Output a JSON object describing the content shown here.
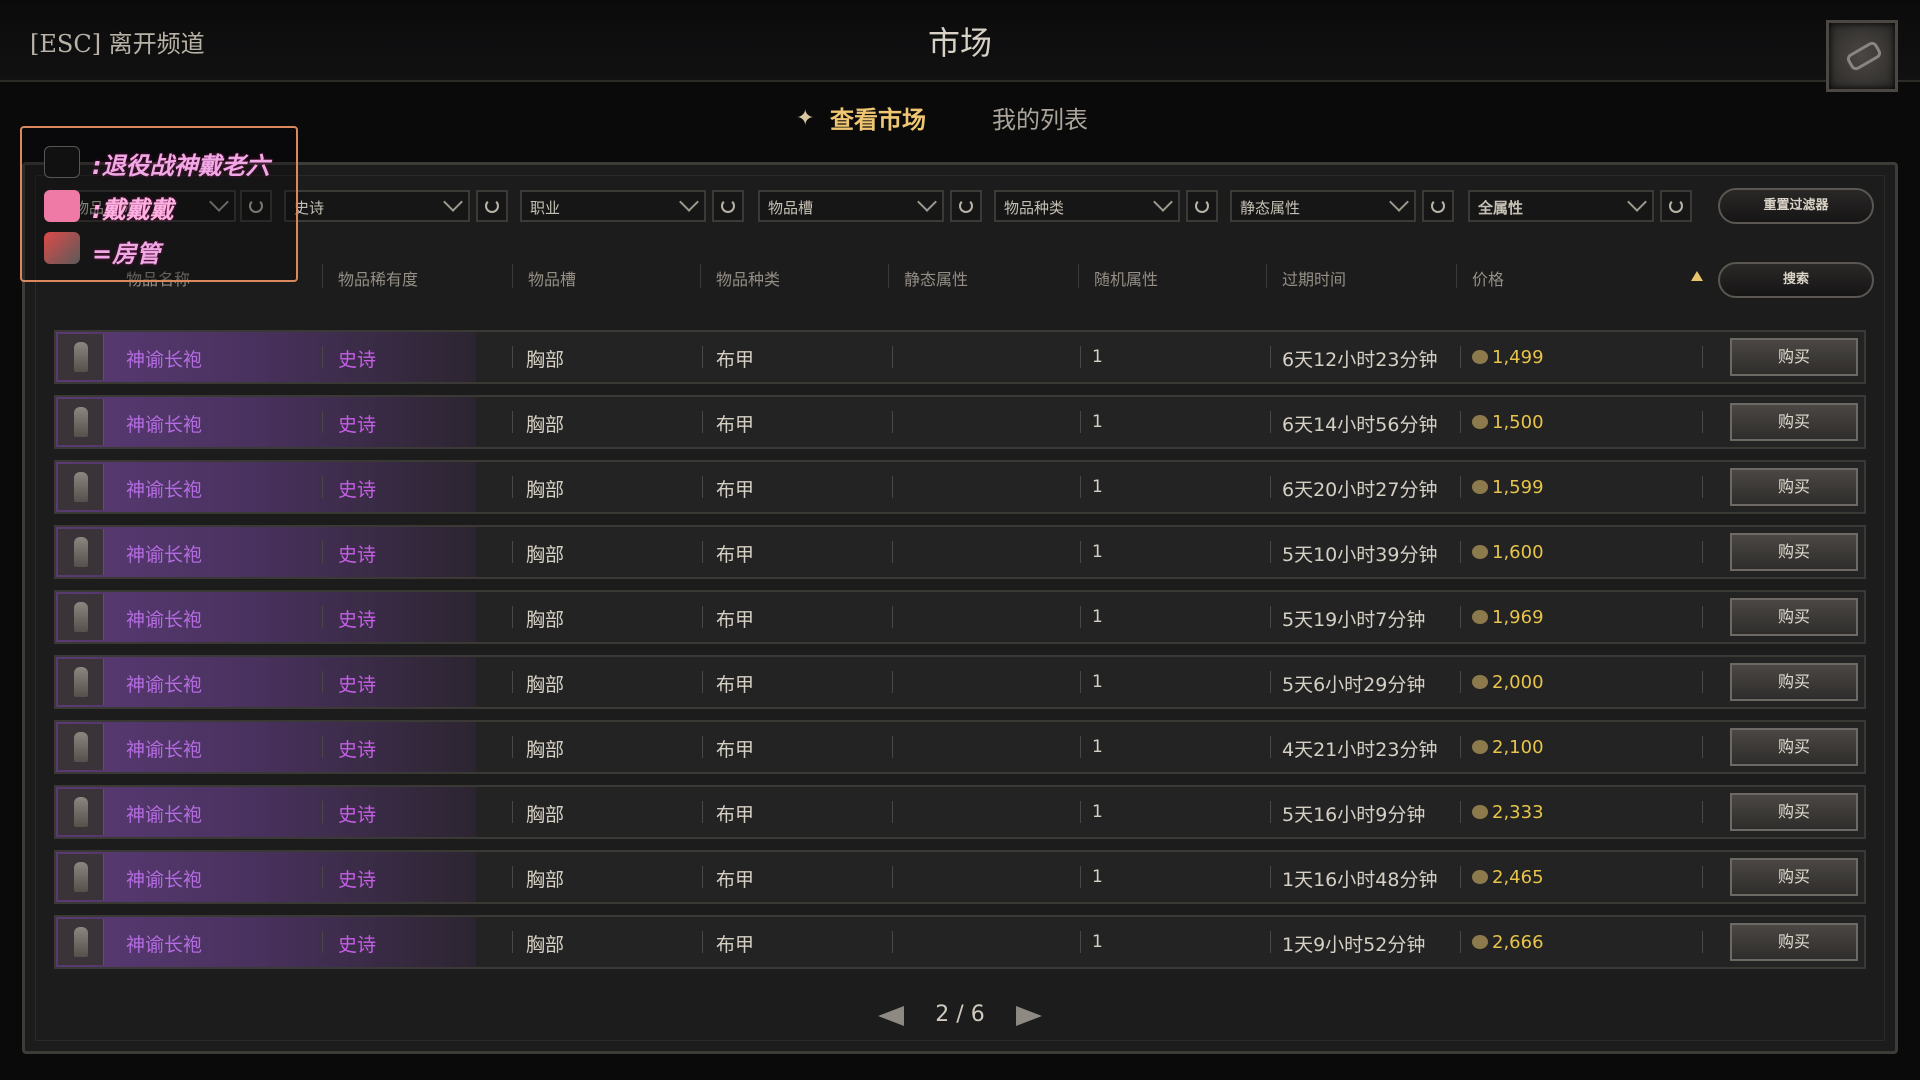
{
  "topbar": {
    "esc_label": "[ESC] 离开频道",
    "title": "市场"
  },
  "tabs": {
    "view_market": "查看市场",
    "my_list": "我的列表"
  },
  "filters": {
    "name_placeholder": "物品名称",
    "rarity": "史诗",
    "class": "职业",
    "slot": "物品槽",
    "item_type": "物品种类",
    "static_attr": "静态属性",
    "all_attr": "全属性",
    "reset_button": "重置过滤器",
    "search_button": "搜索"
  },
  "columns": [
    "物品名称",
    "物品稀有度",
    "物品槽",
    "物品种类",
    "静态属性",
    "随机属性",
    "过期时间",
    "价格"
  ],
  "rows": [
    {
      "name": "神谕长袍",
      "rarity": "史诗",
      "slot": "胸部",
      "type": "布甲",
      "random": "1",
      "expires": "6天12小时23分钟",
      "price": "1,499",
      "buy": "购买"
    },
    {
      "name": "神谕长袍",
      "rarity": "史诗",
      "slot": "胸部",
      "type": "布甲",
      "random": "1",
      "expires": "6天14小时56分钟",
      "price": "1,500",
      "buy": "购买"
    },
    {
      "name": "神谕长袍",
      "rarity": "史诗",
      "slot": "胸部",
      "type": "布甲",
      "random": "1",
      "expires": "6天20小时27分钟",
      "price": "1,599",
      "buy": "购买"
    },
    {
      "name": "神谕长袍",
      "rarity": "史诗",
      "slot": "胸部",
      "type": "布甲",
      "random": "1",
      "expires": "5天10小时39分钟",
      "price": "1,600",
      "buy": "购买"
    },
    {
      "name": "神谕长袍",
      "rarity": "史诗",
      "slot": "胸部",
      "type": "布甲",
      "random": "1",
      "expires": "5天19小时7分钟",
      "price": "1,969",
      "buy": "购买"
    },
    {
      "name": "神谕长袍",
      "rarity": "史诗",
      "slot": "胸部",
      "type": "布甲",
      "random": "1",
      "expires": "5天6小时29分钟",
      "price": "2,000",
      "buy": "购买"
    },
    {
      "name": "神谕长袍",
      "rarity": "史诗",
      "slot": "胸部",
      "type": "布甲",
      "random": "1",
      "expires": "4天21小时23分钟",
      "price": "2,100",
      "buy": "购买"
    },
    {
      "name": "神谕长袍",
      "rarity": "史诗",
      "slot": "胸部",
      "type": "布甲",
      "random": "1",
      "expires": "5天16小时9分钟",
      "price": "2,333",
      "buy": "购买"
    },
    {
      "name": "神谕长袍",
      "rarity": "史诗",
      "slot": "胸部",
      "type": "布甲",
      "random": "1",
      "expires": "1天16小时48分钟",
      "price": "2,465",
      "buy": "购买"
    },
    {
      "name": "神谕长袍",
      "rarity": "史诗",
      "slot": "胸部",
      "type": "布甲",
      "random": "1",
      "expires": "1天9小时52分钟",
      "price": "2,666",
      "buy": "购买"
    }
  ],
  "pagination": {
    "text": "2 / 6"
  },
  "overlay": {
    "douyin": ":退役战神戴老六",
    "bilibili": ":戴戴戴",
    "rocket": "=房管"
  },
  "colors": {
    "epic_purple": "#c55fe6",
    "gold": "#e8c44a",
    "tab_gold": "#efc672"
  }
}
